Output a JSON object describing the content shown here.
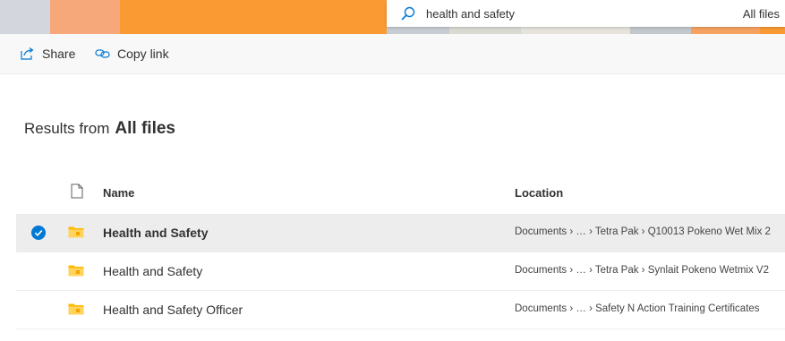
{
  "header": {
    "band_colors": [
      "#d3d6dc",
      "#f7a87b",
      "#f4a06f",
      "#f99a33",
      "#f99a33",
      "#f9b060",
      "#c6ccd2",
      "#d9dbd3",
      "#e6e2dc",
      "#c2c7cc",
      "#f5a261",
      "#f99a33"
    ]
  },
  "search": {
    "query": "health and safety",
    "scope": "All files"
  },
  "command_bar": {
    "share_label": "Share",
    "copy_link_label": "Copy link"
  },
  "results": {
    "prefix": "Results from",
    "scope": "All files"
  },
  "columns": {
    "name": "Name",
    "location": "Location"
  },
  "rows": [
    {
      "name": "Health and Safety",
      "location": "Documents › … › Tetra Pak › Q10013 Pokeno Wet Mix 2",
      "selected": true
    },
    {
      "name": "Health and Safety",
      "location": "Documents › … › Tetra Pak › Synlait Pokeno Wetmix V2",
      "selected": false
    },
    {
      "name": "Health and Safety Officer",
      "location": "Documents › … › Safety N Action Training Certificates",
      "selected": false
    }
  ],
  "colors": {
    "accent": "#0078d4",
    "folder": "#ffb900"
  }
}
